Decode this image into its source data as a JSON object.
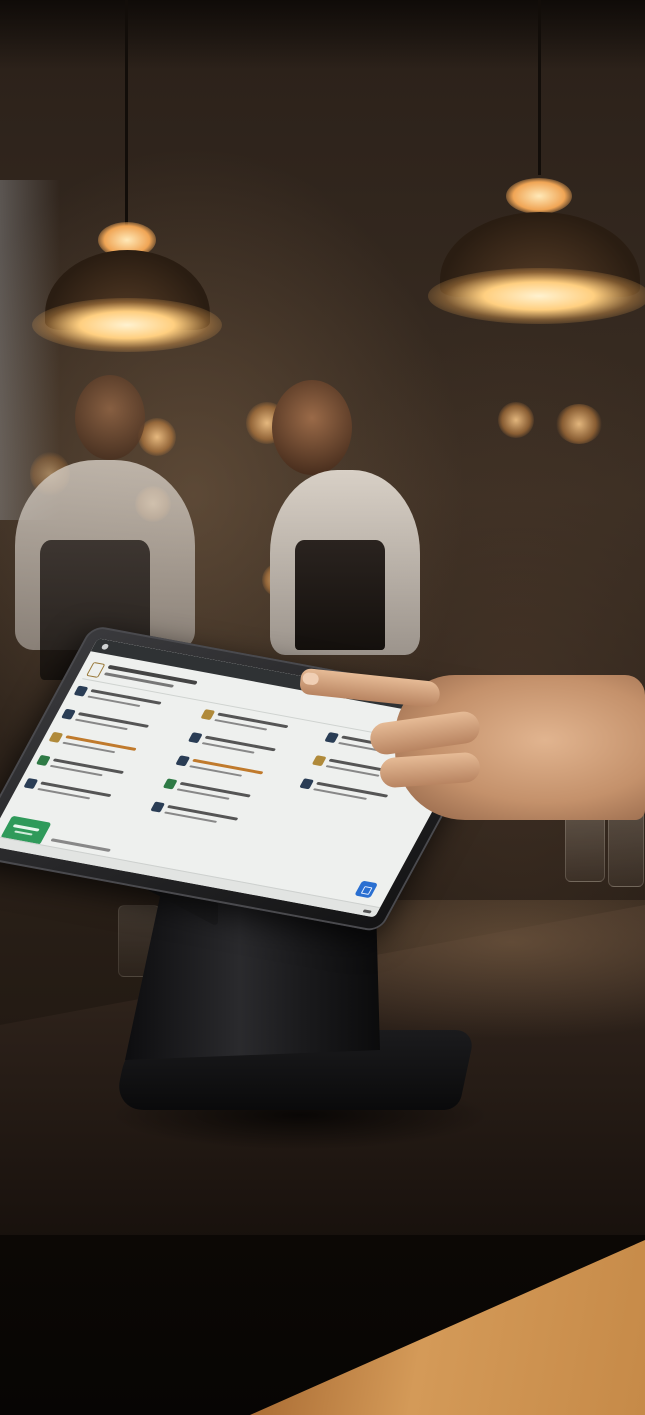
{
  "scene": {
    "description_colors": {
      "ambient": "#2a2019",
      "lamp_glow": "#ffcf80",
      "counter": "#1d1510",
      "wood": "#d49a58"
    }
  },
  "pos_screen": {
    "status_bar": {
      "app_label": "",
      "center_label": ""
    },
    "pay_button_color": "#2f9a5a",
    "action_button_color": "#2a6fd1",
    "footer_brand": ""
  }
}
